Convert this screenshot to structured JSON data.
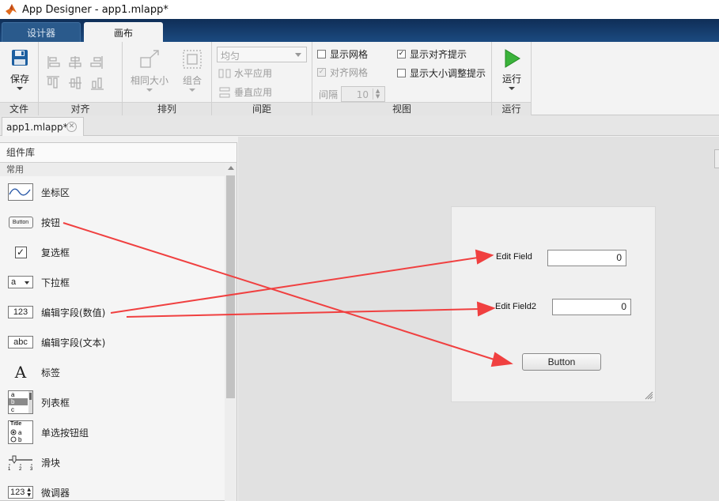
{
  "window": {
    "title": "App Designer - app1.mlapp*"
  },
  "tabs": {
    "design": "设计器",
    "canvas": "画布"
  },
  "ribbon": {
    "file": {
      "save": "保存",
      "group": "文件"
    },
    "align": {
      "group": "对齐"
    },
    "arrange": {
      "same_size": "相同大小",
      "group_btn": "组合",
      "group": "排列"
    },
    "spacing": {
      "dropdown": "均匀",
      "horizontal": "水平应用",
      "vertical": "垂直应用",
      "group": "间距"
    },
    "view": {
      "show_grid": "显示网格",
      "snap_grid": "对齐网格",
      "interval_label": "间隔",
      "interval_value": "10",
      "show_align_hints": "显示对齐提示",
      "show_resize_hints": "显示大小调整提示",
      "group": "视图"
    },
    "run": {
      "run": "运行",
      "group": "运行"
    }
  },
  "document_tab": {
    "label": "app1.mlapp*"
  },
  "library": {
    "header": "组件库",
    "section": "常用",
    "items": [
      {
        "name": "坐标区",
        "icon": "axes-icon"
      },
      {
        "name": "按钮",
        "icon": "button-icon",
        "icon_text": "Button"
      },
      {
        "name": "复选框",
        "icon": "checkbox-icon"
      },
      {
        "name": "下拉框",
        "icon": "dropdown-icon",
        "icon_text": "a"
      },
      {
        "name": "编辑字段(数值)",
        "icon": "numeric-field-icon",
        "icon_text": "123"
      },
      {
        "name": "编辑字段(文本)",
        "icon": "text-field-icon",
        "icon_text": "abc"
      },
      {
        "name": "标签",
        "icon": "label-icon",
        "icon_text": "A"
      },
      {
        "name": "列表框",
        "icon": "listbox-icon"
      },
      {
        "name": "单选按钮组",
        "icon": "radio-group-icon",
        "icon_text": "Title"
      },
      {
        "name": "滑块",
        "icon": "slider-icon"
      },
      {
        "name": "微调器",
        "icon": "spinner-icon",
        "icon_text": "123"
      }
    ]
  },
  "app": {
    "field1": {
      "label": "Edit Field",
      "value": "0"
    },
    "field2": {
      "label": "Edit Field2",
      "value": "0"
    },
    "button": {
      "label": "Button"
    }
  },
  "colors": {
    "annotation_arrow": "#f04040",
    "ribbon_blue": "#1b4a80",
    "run_green": "#3bb33b"
  }
}
